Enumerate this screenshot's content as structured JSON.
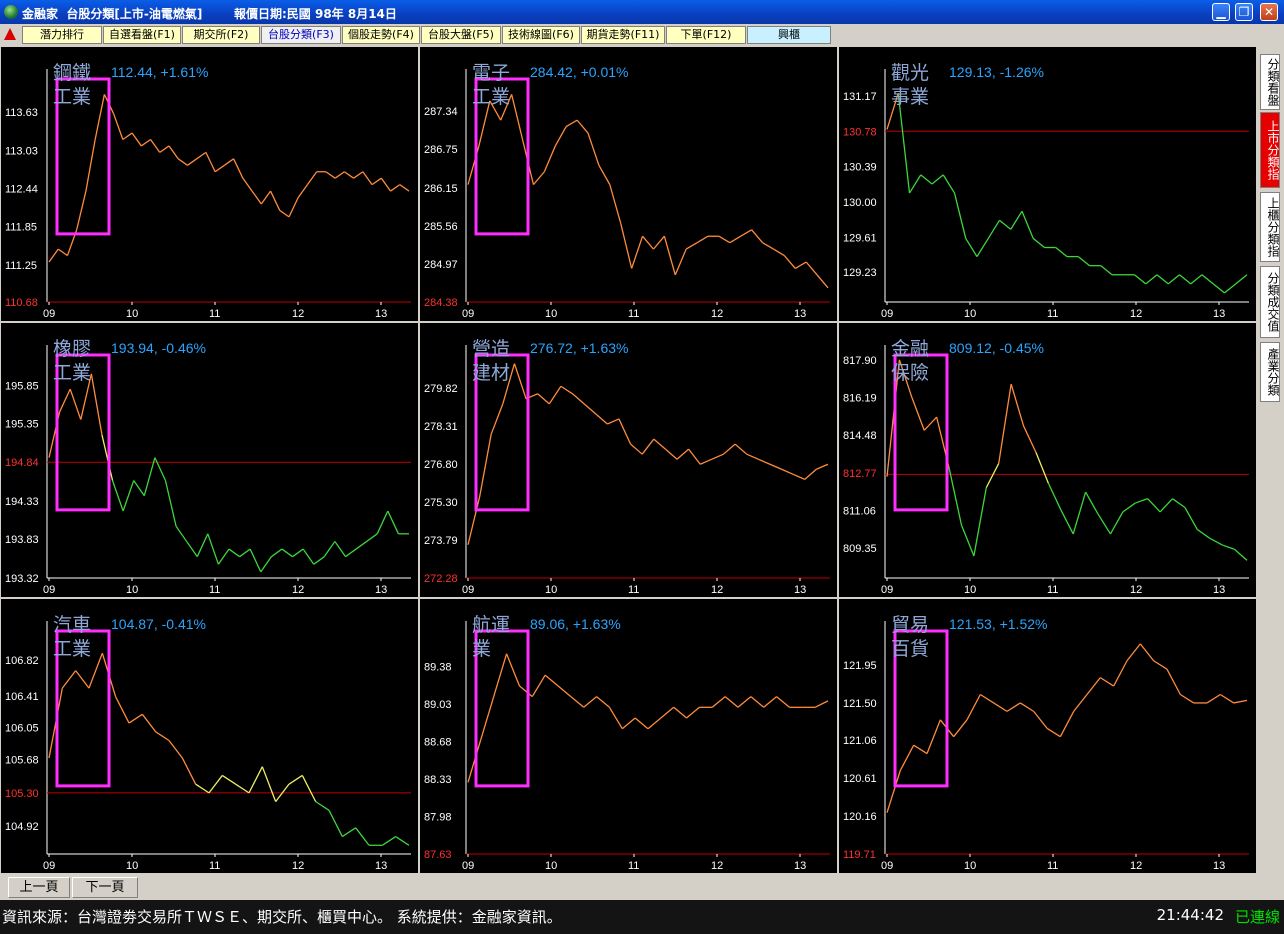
{
  "window": {
    "app_name": "金融家",
    "tab_title": "台股分類[上市-油電燃氣]",
    "report_date": "報價日期:民國 98年 8月14日"
  },
  "menu": {
    "items": [
      "潛力排行",
      "自選看盤(F1)",
      "期交所(F2)",
      "台股分類(F3)",
      "個股走勢(F4)",
      "台股大盤(F5)",
      "技術線圖(F6)",
      "期貨走勢(F11)",
      "下單(F12)",
      "興櫃"
    ],
    "selected": "台股分類(F3)"
  },
  "side_tabs": [
    "分類看盤",
    "上市分類指",
    "上櫃分類指",
    "分類成交值",
    "產業分類"
  ],
  "pager": {
    "prev": "上一頁",
    "next": "下一頁"
  },
  "status": {
    "source": "資訊來源：台灣證劵交易所ＴＷＳＥ、期交所、櫃買中心。 系統提供：金融家資訊。",
    "time": "21:44:42",
    "connection": "已連線"
  },
  "colors": {
    "up": "#ff8c3c",
    "flat": "#f0f060",
    "down": "#3cd63c",
    "highlight": "#ff2eff",
    "ref_line": "#c00000",
    "label": "#2aa4ff",
    "name": "#8fa8d8"
  },
  "x_ticks": [
    "09",
    "10",
    "11",
    "12",
    "13"
  ],
  "chart_data": [
    {
      "type": "line",
      "name_line1": "鋼鐵",
      "name_line2": "工業",
      "value": "112.44",
      "change": "+1.61%",
      "ref": 110.68,
      "yticks": [
        "113.63",
        "113.03",
        "112.44",
        "111.85",
        "111.25",
        "110.68"
      ],
      "ylim": [
        110.68,
        114.2
      ],
      "highlight": [
        0.25,
        1.05
      ],
      "values": [
        111.3,
        111.5,
        111.4,
        111.8,
        112.4,
        113.2,
        113.9,
        113.6,
        113.2,
        113.3,
        113.1,
        113.2,
        113.0,
        113.1,
        112.9,
        112.8,
        112.9,
        113.0,
        112.7,
        112.8,
        112.9,
        112.6,
        112.4,
        112.2,
        112.4,
        112.1,
        112.0,
        112.3,
        112.5,
        112.7,
        112.7,
        112.6,
        112.7,
        112.6,
        112.7,
        112.5,
        112.6,
        112.4,
        112.5,
        112.4
      ]
    },
    {
      "type": "line",
      "name_line1": "電子",
      "name_line2": "工業",
      "value": "284.42",
      "change": "+0.01%",
      "ref": 284.38,
      "yticks": [
        "287.34",
        "286.75",
        "286.15",
        "285.56",
        "284.97",
        "284.38"
      ],
      "ylim": [
        284.38,
        287.9
      ],
      "highlight": [
        0.2,
        1.15
      ],
      "values": [
        286.2,
        286.8,
        287.5,
        287.2,
        287.6,
        286.9,
        286.2,
        286.4,
        286.8,
        287.1,
        287.2,
        287.0,
        286.5,
        286.2,
        285.6,
        284.9,
        285.4,
        285.2,
        285.4,
        284.8,
        285.2,
        285.3,
        285.4,
        285.4,
        285.3,
        285.4,
        285.5,
        285.3,
        285.2,
        285.1,
        284.9,
        285.0,
        284.8,
        284.6
      ]
    },
    {
      "type": "line",
      "name_line1": "觀光",
      "name_line2": "事業",
      "value": "129.13",
      "change": "-1.26%",
      "ref": 130.78,
      "yticks": [
        "131.17",
        "130.78",
        "130.39",
        "130.00",
        "129.61",
        "129.23"
      ],
      "ylim": [
        128.9,
        131.4
      ],
      "highlight": null,
      "values": [
        130.8,
        131.2,
        130.1,
        130.3,
        130.2,
        130.3,
        130.1,
        129.6,
        129.4,
        129.6,
        129.8,
        129.7,
        129.9,
        129.6,
        129.5,
        129.5,
        129.4,
        129.4,
        129.3,
        129.3,
        129.2,
        129.2,
        129.2,
        129.1,
        129.2,
        129.1,
        129.2,
        129.1,
        129.2,
        129.1,
        129.0,
        129.1,
        129.2
      ]
    },
    {
      "type": "line",
      "name_line1": "橡膠",
      "name_line2": "工業",
      "value": "193.94",
      "change": "-0.46%",
      "ref": 194.84,
      "yticks": [
        "195.85",
        "195.35",
        "194.84",
        "194.33",
        "193.83",
        "193.32"
      ],
      "ylim": [
        193.32,
        196.3
      ],
      "highlight": [
        0.15,
        1.45
      ],
      "values": [
        194.9,
        195.5,
        195.8,
        195.4,
        196.0,
        195.2,
        194.6,
        194.2,
        194.6,
        194.4,
        194.9,
        194.6,
        194.0,
        193.8,
        193.6,
        193.9,
        193.5,
        193.7,
        193.6,
        193.7,
        193.4,
        193.6,
        193.7,
        193.6,
        193.7,
        193.5,
        193.6,
        193.8,
        193.6,
        193.7,
        193.8,
        193.9,
        194.2,
        193.9,
        193.9
      ]
    },
    {
      "type": "line",
      "name_line1": "營造",
      "name_line2": "建材",
      "value": "276.72",
      "change": "+1.63%",
      "ref": 272.28,
      "yticks": [
        "279.82",
        "278.31",
        "276.80",
        "275.30",
        "273.79",
        "272.28"
      ],
      "ylim": [
        272.28,
        281.3
      ],
      "highlight": [
        0.05,
        1.25
      ],
      "values": [
        273.6,
        275.5,
        278.0,
        279.2,
        280.8,
        279.4,
        279.6,
        279.2,
        279.9,
        279.6,
        279.2,
        278.8,
        278.4,
        278.6,
        277.6,
        277.2,
        277.8,
        277.4,
        277.0,
        277.4,
        276.8,
        277.0,
        277.2,
        277.6,
        277.2,
        277.0,
        276.8,
        276.6,
        276.4,
        276.2,
        276.6,
        276.8
      ]
    },
    {
      "type": "line",
      "name_line1": "金融",
      "name_line2": "保險",
      "value": "809.12",
      "change": "-0.45%",
      "ref": 812.7,
      "yticks": [
        "817.90",
        "816.19",
        "814.48",
        "812.77",
        "811.06",
        "809.35"
      ],
      "ylim": [
        808.0,
        818.3
      ],
      "highlight": [
        0.0,
        1.0
      ],
      "values": [
        812.6,
        817.9,
        816.2,
        814.7,
        815.3,
        813.0,
        810.4,
        809.0,
        812.1,
        813.2,
        816.8,
        814.9,
        813.7,
        812.3,
        811.1,
        810.0,
        811.9,
        810.9,
        810.0,
        811.0,
        811.4,
        811.6,
        811.0,
        811.6,
        811.2,
        810.2,
        809.8,
        809.5,
        809.3,
        808.8
      ]
    },
    {
      "type": "line",
      "name_line1": "汽車",
      "name_line2": "工業",
      "value": "104.87",
      "change": "-0.41%",
      "ref": 105.3,
      "yticks": [
        "106.82",
        "106.41",
        "106.05",
        "105.68",
        "105.30",
        "104.92"
      ],
      "ylim": [
        104.6,
        107.2
      ],
      "highlight": [
        0.05,
        1.1
      ],
      "values": [
        105.7,
        106.5,
        106.7,
        106.5,
        106.9,
        106.4,
        106.1,
        106.2,
        106.0,
        105.9,
        105.7,
        105.4,
        105.3,
        105.5,
        105.4,
        105.3,
        105.6,
        105.2,
        105.4,
        105.5,
        105.2,
        105.1,
        104.8,
        104.9,
        104.7,
        104.7,
        104.8,
        104.7
      ]
    },
    {
      "type": "line",
      "name_line1": "航運",
      "name_line2": "業",
      "value": "89.06",
      "change": "+1.63%",
      "ref": 87.63,
      "yticks": [
        "89.38",
        "89.03",
        "88.68",
        "88.33",
        "87.98",
        "87.63"
      ],
      "ylim": [
        87.63,
        89.75
      ],
      "highlight": [
        0.0,
        1.1
      ],
      "values": [
        88.3,
        88.7,
        89.1,
        89.5,
        89.2,
        89.1,
        89.3,
        89.2,
        89.1,
        89.0,
        89.1,
        89.0,
        88.8,
        88.9,
        88.8,
        88.9,
        89.0,
        88.9,
        89.0,
        89.0,
        89.1,
        89.0,
        89.1,
        89.0,
        89.1,
        89.0,
        89.0,
        89.0,
        89.06
      ]
    },
    {
      "type": "line",
      "name_line1": "貿易",
      "name_line2": "百貨",
      "value": "121.53",
      "change": "+1.52%",
      "ref": 119.71,
      "yticks": [
        "121.95",
        "121.50",
        "121.06",
        "120.61",
        "120.16",
        "119.71"
      ],
      "ylim": [
        119.71,
        122.4
      ],
      "highlight": [
        0.0,
        1.0
      ],
      "values": [
        120.2,
        120.7,
        121.0,
        120.9,
        121.3,
        121.1,
        121.3,
        121.6,
        121.5,
        121.4,
        121.5,
        121.4,
        121.2,
        121.1,
        121.4,
        121.6,
        121.8,
        121.7,
        122.0,
        122.2,
        122.0,
        121.9,
        121.6,
        121.5,
        121.5,
        121.6,
        121.5,
        121.53
      ]
    }
  ]
}
